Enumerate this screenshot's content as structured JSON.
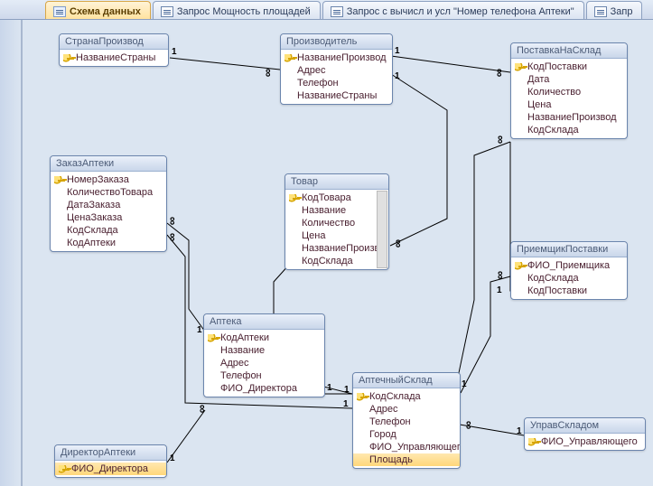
{
  "tabs": [
    {
      "label": "Схема данных",
      "active": true
    },
    {
      "label": "Запрос Мощность площадей",
      "active": false
    },
    {
      "label": "Запрос с вычисл и усл \"Номер телефона Аптеки\"",
      "active": false
    },
    {
      "label": "Запр",
      "active": false
    }
  ],
  "entities": {
    "country": {
      "title": "СтранаПроизвод",
      "fields": [
        {
          "name": "НазваниеСтраны",
          "pk": true
        }
      ]
    },
    "manufacturer": {
      "title": "Производитель",
      "fields": [
        {
          "name": "НазваниеПроизвод",
          "pk": true
        },
        {
          "name": "Адрес"
        },
        {
          "name": "Телефон"
        },
        {
          "name": "НазваниеСтраны"
        }
      ]
    },
    "delivery": {
      "title": "ПоставкаНаСклад",
      "fields": [
        {
          "name": "КодПоставки",
          "pk": true
        },
        {
          "name": "Дата"
        },
        {
          "name": "Количество"
        },
        {
          "name": "Цена"
        },
        {
          "name": "НазваниеПроизвод"
        },
        {
          "name": "КодСклада"
        }
      ]
    },
    "order": {
      "title": "ЗаказАптеки",
      "fields": [
        {
          "name": "НомерЗаказа",
          "pk": true
        },
        {
          "name": "КоличествоТовара"
        },
        {
          "name": "ДатаЗаказа"
        },
        {
          "name": "ЦенаЗаказа"
        },
        {
          "name": "КодСклада"
        },
        {
          "name": "КодАптеки"
        }
      ]
    },
    "product": {
      "title": "Товар",
      "fields": [
        {
          "name": "КодТовара",
          "pk": true
        },
        {
          "name": "Название"
        },
        {
          "name": "Количество"
        },
        {
          "name": "Цена"
        },
        {
          "name": "НазваниеПроизв"
        },
        {
          "name": "КодСклада"
        }
      ]
    },
    "receiver": {
      "title": "ПриемщикПоставки",
      "fields": [
        {
          "name": "ФИО_Приемщика",
          "pk": true
        },
        {
          "name": "КодСклада"
        },
        {
          "name": "КодПоставки"
        }
      ]
    },
    "pharmacy": {
      "title": "Аптека",
      "fields": [
        {
          "name": "КодАптеки",
          "pk": true
        },
        {
          "name": "Название"
        },
        {
          "name": "Адрес"
        },
        {
          "name": "Телефон"
        },
        {
          "name": "ФИО_Директора"
        }
      ]
    },
    "director": {
      "title": "ДиректорАптеки",
      "fields": [
        {
          "name": "ФИО_Директора",
          "pk": true,
          "selected": true
        }
      ]
    },
    "warehouse": {
      "title": "АптечныйСклад",
      "fields": [
        {
          "name": "КодСклада",
          "pk": true
        },
        {
          "name": "Адрес"
        },
        {
          "name": "Телефон"
        },
        {
          "name": "Город"
        },
        {
          "name": "ФИО_Управляющего"
        },
        {
          "name": "Площадь",
          "selected": true
        }
      ]
    },
    "manager": {
      "title": "УправСкладом",
      "fields": [
        {
          "name": "ФИО_Управляющего",
          "pk": true
        }
      ]
    }
  },
  "rel_glyph": {
    "one": "1",
    "many": "∞"
  },
  "chart_data": {
    "type": "diagram",
    "note": "MS Access relationship (ER) diagram",
    "entities": [
      "СтранаПроизвод",
      "Производитель",
      "ПоставкаНаСклад",
      "ЗаказАптеки",
      "Товар",
      "ПриемщикПоставки",
      "Аптека",
      "ДиректорАптеки",
      "АптечныйСклад",
      "УправСкладом"
    ],
    "relationships": [
      {
        "from": "СтранаПроизвод.НазваниеСтраны",
        "to": "Производитель.НазваниеСтраны",
        "card": "1:∞"
      },
      {
        "from": "Производитель.НазваниеПроизвод",
        "to": "ПоставкаНаСклад.НазваниеПроизвод",
        "card": "1:∞"
      },
      {
        "from": "Производитель.НазваниеПроизвод",
        "to": "Товар.НазваниеПроизв",
        "card": "1:∞"
      },
      {
        "from": "АптечныйСклад.КодСклада",
        "to": "Товар.КодСклада",
        "card": "1:∞"
      },
      {
        "from": "АптечныйСклад.КодСклада",
        "to": "ПоставкаНаСклад.КодСклада",
        "card": "1:∞"
      },
      {
        "from": "АптечныйСклад.КодСклада",
        "to": "ЗаказАптеки.КодСклада",
        "card": "1:∞"
      },
      {
        "from": "АптечныйСклад.КодСклада",
        "to": "ПриемщикПоставки.КодСклада",
        "card": "1:∞"
      },
      {
        "from": "ПоставкаНаСклад.КодПоставки",
        "to": "ПриемщикПоставки.КодПоставки",
        "card": "1:∞"
      },
      {
        "from": "Аптека.КодАптеки",
        "to": "ЗаказАптеки.КодАптеки",
        "card": "1:∞"
      },
      {
        "from": "ДиректорАптеки.ФИО_Директора",
        "to": "Аптека.ФИО_Директора",
        "card": "1:∞"
      },
      {
        "from": "УправСкладом.ФИО_Управляющего",
        "to": "АптечныйСклад.ФИО_Управляющего",
        "card": "1:∞"
      }
    ]
  }
}
